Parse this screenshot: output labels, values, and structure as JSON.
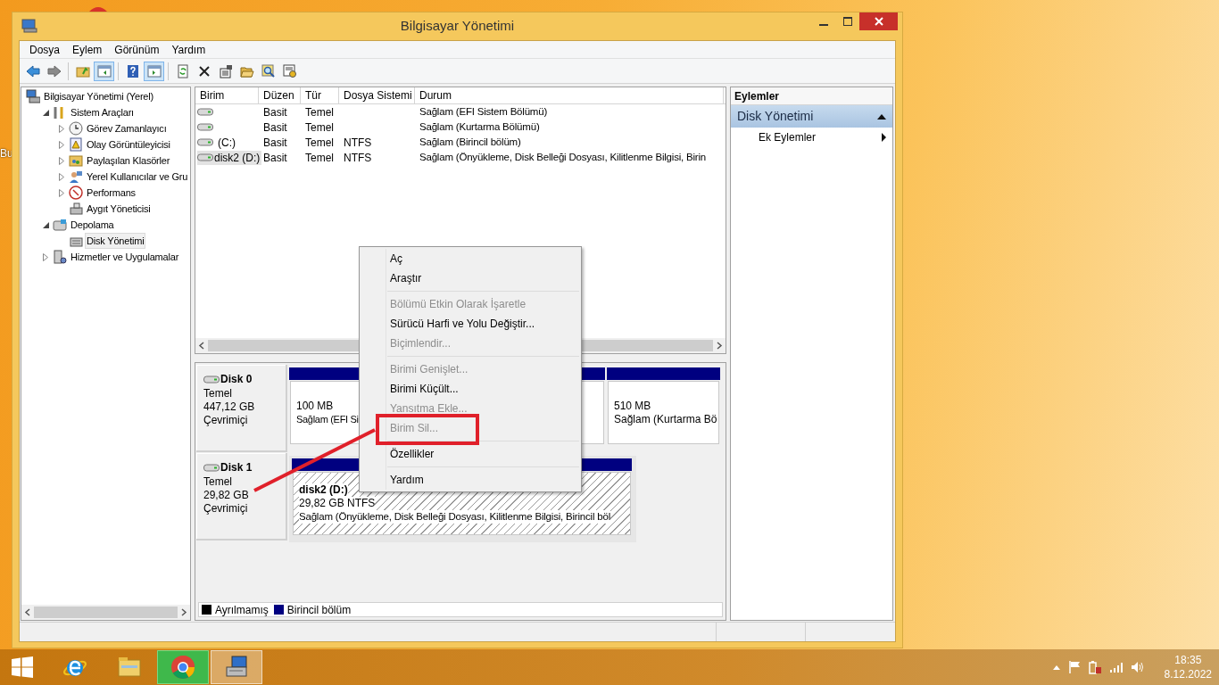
{
  "desktop": {
    "icon_label": "Bu"
  },
  "window": {
    "title": "Bilgisayar Yönetimi"
  },
  "menu": [
    "Dosya",
    "Eylem",
    "Görünüm",
    "Yardım"
  ],
  "toolbar": [
    {
      "pressed": false
    },
    {
      "pressed": false
    },
    {
      "pressed": false
    },
    {
      "pressed": true
    },
    {
      "pressed": false
    },
    {
      "pressed": true
    },
    {
      "pressed": false
    },
    {
      "pressed": false
    },
    {
      "pressed": false
    },
    {
      "pressed": false
    },
    {
      "pressed": false
    },
    {
      "pressed": false
    }
  ],
  "tree": [
    {
      "label": "Bilgisayar Yönetimi (Yerel)",
      "selected": false,
      "children": [
        {
          "label": "Sistem Araçları",
          "expanded": true,
          "selected": false,
          "children": [
            {
              "label": "Görev Zamanlayıcı",
              "expanded": false,
              "selected": false
            },
            {
              "label": "Olay Görüntüleyicisi",
              "expanded": false,
              "selected": false
            },
            {
              "label": "Paylaşılan Klasörler",
              "expanded": false,
              "selected": false
            },
            {
              "label": "Yerel Kullanıcılar ve Gru",
              "expanded": false,
              "selected": false
            },
            {
              "label": "Performans",
              "expanded": false,
              "selected": false
            },
            {
              "label": "Aygıt Yöneticisi",
              "selected": false
            }
          ]
        },
        {
          "label": "Depolama",
          "expanded": true,
          "selected": false,
          "children": [
            {
              "label": "Disk Yönetimi",
              "selected": true
            }
          ]
        },
        {
          "label": "Hizmetler ve Uygulamalar",
          "expanded": false,
          "selected": false
        }
      ]
    }
  ],
  "volumes": {
    "columns": [
      "Birim",
      "Düzen",
      "Tür",
      "Dosya Sistemi",
      "Durum"
    ],
    "rows": [
      {
        "selected": false,
        "cells": [
          "",
          "Basit",
          "Temel",
          "",
          "Sağlam (EFI Sistem Bölümü)"
        ]
      },
      {
        "selected": false,
        "cells": [
          "",
          "Basit",
          "Temel",
          "",
          "Sağlam (Kurtarma Bölümü)"
        ]
      },
      {
        "selected": false,
        "cells": [
          "(C:)",
          "Basit",
          "Temel",
          "NTFS",
          "Sağlam (Birincil bölüm)"
        ]
      },
      {
        "selected": true,
        "cells": [
          "disk2 (D:)",
          "Basit",
          "Temel",
          "NTFS",
          "Sağlam (Önyükleme, Disk Belleği Dosyası, Kilitlenme Bilgisi, Birin"
        ]
      }
    ]
  },
  "disks": [
    {
      "name": "Disk 0",
      "type": "Temel",
      "size": "447,12 GB",
      "status": "Çevrimiçi",
      "partitions": [
        {
          "selected": false,
          "lines": [
            "100 MB",
            "Sağlam (EFI Si"
          ]
        },
        {
          "selected": false
        },
        {
          "selected": false,
          "lines": [
            "510 MB",
            "Sağlam (Kurtarma Bö"
          ]
        }
      ]
    },
    {
      "name": "Disk 1",
      "type": "Temel",
      "size": "29,82 GB",
      "status": "Çevrimiçi",
      "partitions": [
        {
          "selected": true,
          "title": "disk2  (D:)",
          "lines": [
            "29,82 GB NTFS",
            "Sağlam (Önyükleme, Disk Belleği Dosyası, Kilitlenme Bilgisi, Birincil böl"
          ]
        }
      ]
    }
  ],
  "legend": [
    {
      "label": "Ayrılmamış",
      "color": "#000000"
    },
    {
      "label": "Birincil bölüm",
      "color": "#000080"
    }
  ],
  "actions": {
    "header": "Eylemler",
    "section": {
      "label": "Disk Yönetimi",
      "expanded": true
    },
    "items": [
      {
        "label": "Ek Eylemler",
        "submenu": true
      }
    ]
  },
  "context_menu": [
    {
      "kind": "item",
      "label": "Aç",
      "disabled": false
    },
    {
      "kind": "item",
      "label": "Araştır",
      "disabled": false
    },
    {
      "kind": "separator"
    },
    {
      "kind": "item",
      "label": "Bölümü Etkin Olarak İşaretle",
      "disabled": true
    },
    {
      "kind": "item",
      "label": "Sürücü Harfi ve Yolu Değiştir...",
      "disabled": false
    },
    {
      "kind": "item",
      "label": "Biçimlendir...",
      "disabled": true
    },
    {
      "kind": "separator"
    },
    {
      "kind": "item",
      "label": "Birimi Genişlet...",
      "disabled": true
    },
    {
      "kind": "item",
      "label": "Birimi Küçült...",
      "disabled": false
    },
    {
      "kind": "item",
      "label": "Yansıtma Ekle...",
      "disabled": true
    },
    {
      "kind": "item",
      "label": "Birim Sil...",
      "disabled": true
    },
    {
      "kind": "separator"
    },
    {
      "kind": "item",
      "label": "Özellikler",
      "disabled": false
    },
    {
      "kind": "separator"
    },
    {
      "kind": "item",
      "label": "Yardım",
      "disabled": false
    }
  ],
  "taskbar": {
    "apps": [
      {
        "selected": false,
        "hovered": false
      },
      {
        "selected": false,
        "hovered": false
      },
      {
        "selected": false,
        "hovered": true
      },
      {
        "selected": true,
        "hovered": false
      }
    ],
    "clock": {
      "time": "18:35",
      "date": "8.12.2022"
    }
  }
}
